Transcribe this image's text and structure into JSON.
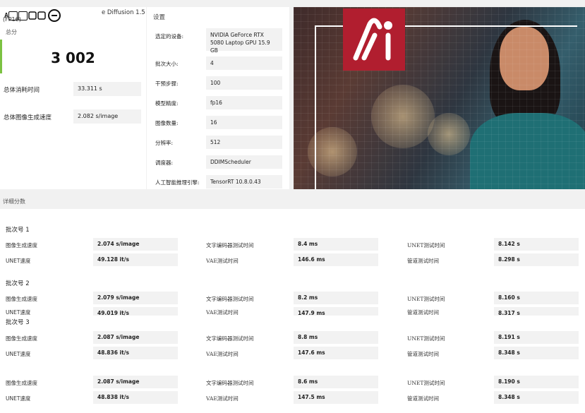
{
  "summary": {
    "title_suffix": "e Diffusion 1.5",
    "title_line2": "(FP16)",
    "logo_text": "A",
    "score_label": "总分",
    "score": "3 002",
    "total_time_label": "总体消耗时间",
    "total_time": "33.311 s",
    "gen_speed_label": "总体图像生成速度",
    "gen_speed": "2.082 s/image"
  },
  "settings": {
    "title": "设置",
    "rows": [
      {
        "label": "选定的设备:",
        "value": "NVIDIA GeForce RTX 5080 Laptop GPU 15.9 GB"
      },
      {
        "label": "批次大小:",
        "value": "4"
      },
      {
        "label": "干预步骤:",
        "value": "100"
      },
      {
        "label": "模型精度:",
        "value": "fp16"
      },
      {
        "label": "图像数量:",
        "value": "16"
      },
      {
        "label": "分辨率:",
        "value": "512"
      },
      {
        "label": "调度器:",
        "value": "DDIMScheduler"
      },
      {
        "label": "人工智能推理引擎:",
        "value": "TensorRT 10.8.0.43"
      }
    ]
  },
  "hero": {
    "logo_icon": "ai-logo-icon"
  },
  "details": {
    "title": "详细分数",
    "labels": {
      "gen": "图像生成速度",
      "unet_speed": "UNET速度",
      "text_enc": "文字编码器测试时间",
      "vae": "VAE测试时间",
      "unet_time": "UNET测试时间",
      "pipeline": "管道测试时间"
    },
    "batches": [
      {
        "title": "批次号 1",
        "gen": "2.074 s/image",
        "unet_speed": "49.128 it/s",
        "text_enc": "8.4 ms",
        "vae": "146.6 ms",
        "unet_time": "8.142 s",
        "pipeline": "8.298 s"
      },
      {
        "title": "批次号 2",
        "gen": "2.079 s/image",
        "unet_speed": "49.019 it/s",
        "text_enc": "8.2 ms",
        "vae": "147.9 ms",
        "unet_time": "8.160 s",
        "pipeline": "8.317 s"
      },
      {
        "title": "批次号 3",
        "gen": "2.087 s/image",
        "unet_speed": "48.836 it/s",
        "text_enc": "8.8 ms",
        "vae": "147.6 ms",
        "unet_time": "8.191 s",
        "pipeline": "8.348 s"
      },
      {
        "title": "",
        "gen": "2.087 s/image",
        "unet_speed": "48.838 it/s",
        "text_enc": "8.6 ms",
        "vae": "147.5 ms",
        "unet_time": "8.190 s",
        "pipeline": "8.348 s"
      }
    ]
  }
}
